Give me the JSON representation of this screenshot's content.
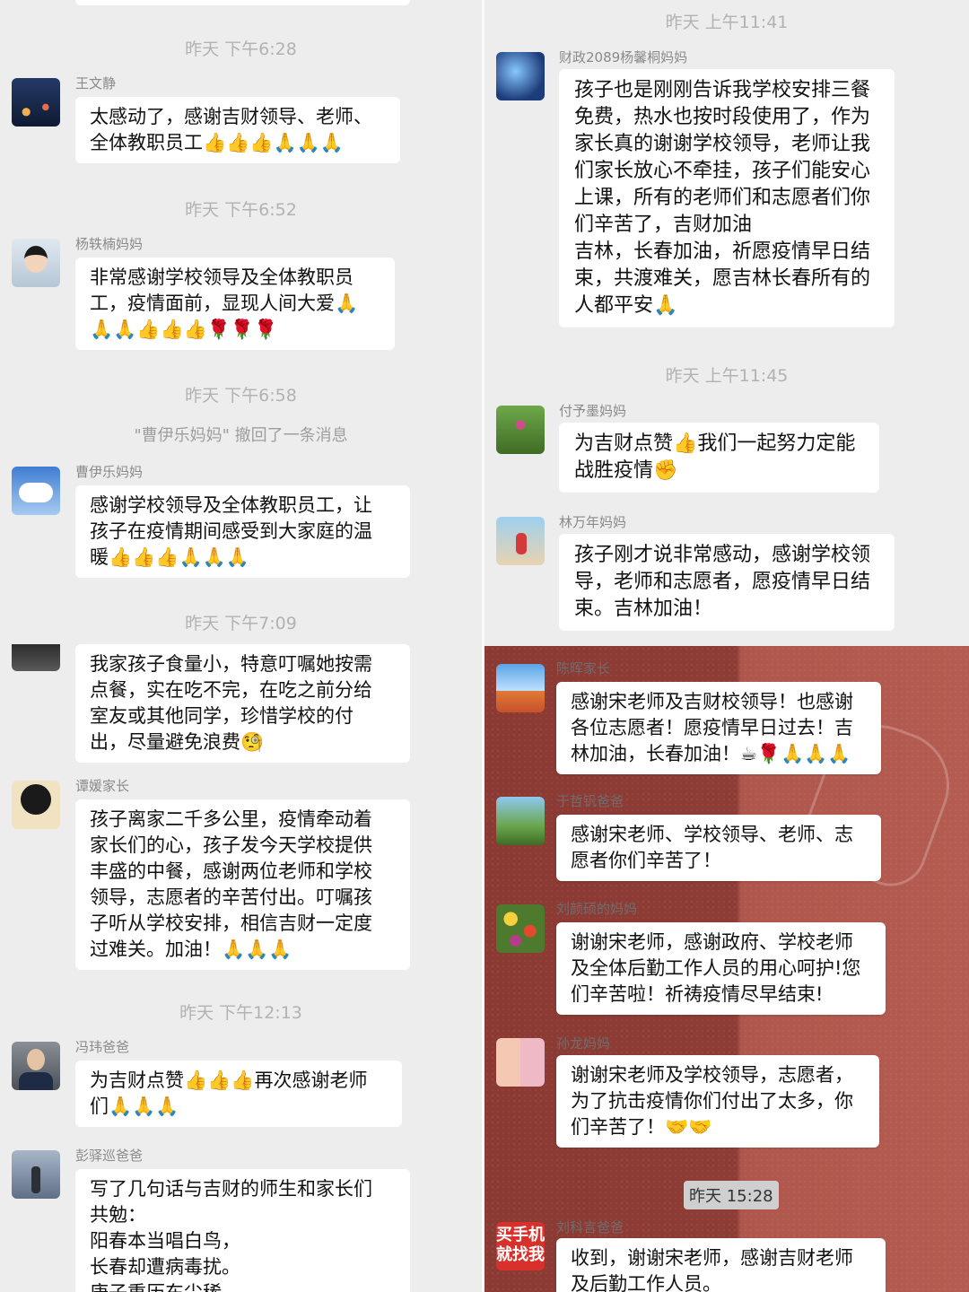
{
  "left": {
    "ts1": "昨天 下午6:28",
    "msg1": {
      "name": "王文静",
      "text": "太感动了，感谢吉财领导、老师、\n全体教职员工👍👍👍🙏🙏🙏"
    },
    "ts2": "昨天 下午6:52",
    "msg2": {
      "name": "杨轶楠妈妈",
      "text": "非常感谢学校领导及全体教职员\n工，疫情面前，显现人间大爱🙏\n🙏🙏👍👍👍🌹🌹🌹"
    },
    "ts3": "昨天 下午6:58",
    "recall": "\"曹伊乐妈妈\" 撤回了一条消息",
    "msg3": {
      "name": "曹伊乐妈妈",
      "text": "感谢学校领导及全体教职员工，让\n孩子在疫情期间感受到大家庭的温\n暖👍👍👍🙏🙏🙏"
    },
    "ts4": "昨天 下午7:09",
    "msg4": {
      "text": "我家孩子食量小，特意叮嘱她按需\n点餐，实在吃不完，在吃之前分给\n室友或其他同学，珍惜学校的付\n出，尽量避免浪费🧐"
    },
    "msg5": {
      "name": "谭媛家长",
      "text": "孩子离家二千多公里，疫情牵动着\n家长们的心，孩子发今天学校提供\n丰盛的中餐，感谢两位老师和学校\n领导，志愿者的辛苦付出。叮嘱孩\n子听从学校安排，相信吉财一定度\n过难关。加油！🙏🙏🙏"
    },
    "ts5": "昨天 下午12:13",
    "msg6": {
      "name": "冯玮爸爸",
      "text": "为吉财点赞👍👍👍再次感谢老师\n们🙏🙏🙏"
    },
    "msg7": {
      "name": "彭驿巡爸爸",
      "text": "写了几句话与吉财的师生和家长们\n共勉：\n阳春本当唱白鸟，\n长春却遭病毒扰。\n庚子重历东尘稀"
    }
  },
  "right_top": {
    "ts1": "昨天 上午11:41",
    "msg1": {
      "name": "财政2089杨馨桐妈妈",
      "text": "孩子也是刚刚告诉我学校安排三餐\n免费，热水也按时段使用了，作为\n家长真的谢谢学校领导，老师让我\n们家长放心不牵挂，孩子们能安心\n上课，所有的老师们和志愿者们你\n们辛苦了，吉财加油\n吉林，长春加油，祈愿疫情早日结\n束，共渡难关，愿吉林长春所有的\n人都平安🙏"
    },
    "ts2": "昨天 上午11:45",
    "msg2": {
      "name": "付予墨妈妈",
      "text": "为吉财点赞👍我们一起努力定能\n战胜疫情✊"
    },
    "msg3": {
      "name": "林万年妈妈",
      "text": "孩子刚才说非常感动，感谢学校领\n导，老师和志愿者，愿疫情早日结\n束。吉林加油！"
    }
  },
  "right_bottom": {
    "msg1": {
      "name": "陈晖家长",
      "text": "感谢宋老师及吉财校领导！也感谢\n各位志愿者！愿疫情早日过去！吉\n林加油，长春加油！☕🌹🙏🙏🙏"
    },
    "msg2": {
      "name": "于哲钒爸爸",
      "text": "感谢宋老师、学校领导、老师、志\n愿者你们辛苦了！"
    },
    "msg3": {
      "name": "刘颜硕的妈妈",
      "text": "谢谢宋老师，感谢政府、学校老师\n及全体后勤工作人员的用心呵护!您\n们辛苦啦！祈祷疫情尽早结束!"
    },
    "msg4": {
      "name": "孙龙妈妈",
      "text": "谢谢宋老师及学校领导，志愿者，\n为了抗击疫情你们付出了太多，你\n们辛苦了！🤝🤝"
    },
    "ts1": "昨天 15:28",
    "msg5": {
      "name": "刘科言爸爸",
      "avatar_text": "买手机\n就找我",
      "text": "收到，谢谢宋老师，感谢吉财老师\n及后勤工作人员。"
    }
  },
  "colors": {
    "bubble": "#ffffff",
    "chat_bg": "#ededed",
    "timestamp": "#b2b2b2",
    "dark_bg": "#8b3a33",
    "dark_bg_light": "#b45c51"
  }
}
